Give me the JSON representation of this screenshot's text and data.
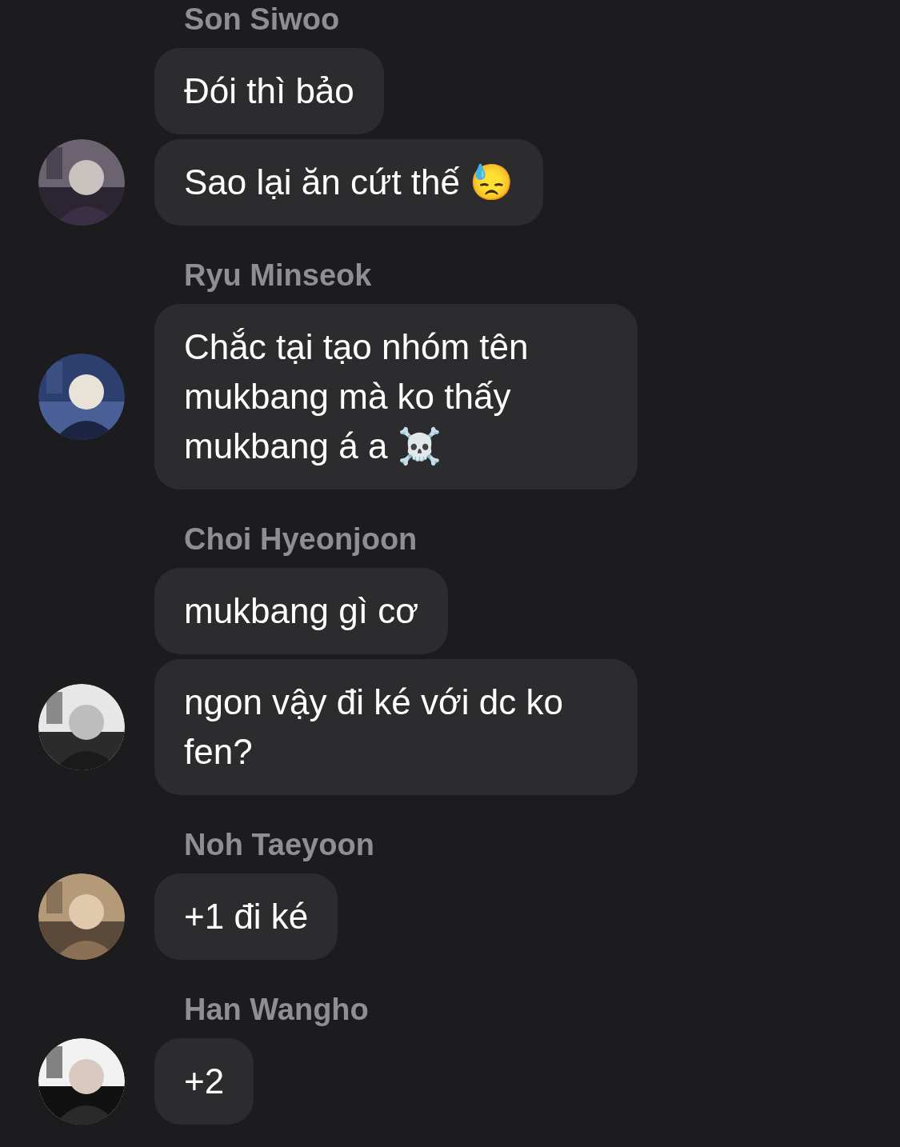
{
  "groups": [
    {
      "sender": "Son Siwoo",
      "messages": [
        "Đói thì bảo",
        "Sao lại ăn cứt thế 😓"
      ]
    },
    {
      "sender": "Ryu Minseok",
      "messages": [
        "Chắc tại tạo nhóm tên mukbang mà ko thấy mukbang á a ☠️"
      ]
    },
    {
      "sender": "Choi Hyeonjoon",
      "messages": [
        "mukbang gì cơ",
        "ngon vậy đi ké với dc ko fen?"
      ]
    },
    {
      "sender": "Noh Taeyoon",
      "messages": [
        "+1 đi ké"
      ]
    },
    {
      "sender": "Han Wangho",
      "messages": [
        "+2"
      ]
    }
  ]
}
